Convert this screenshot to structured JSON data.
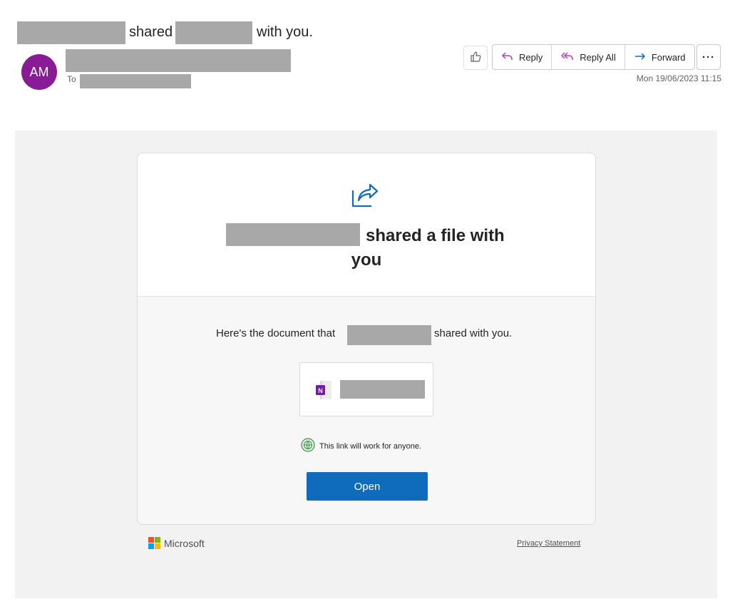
{
  "header": {
    "subject_shared": "shared",
    "subject_with_you": "with you.",
    "avatar_initials": "AM",
    "to_label": "To",
    "timestamp": "Mon 19/06/2023 11:15"
  },
  "actions": {
    "reply": "Reply",
    "reply_all": "Reply All",
    "forward": "Forward",
    "more": "···"
  },
  "card": {
    "headline_part1": "shared a file with",
    "headline_part2": "you",
    "message_prefix": "Here's the document that",
    "message_suffix": "shared with you.",
    "link_note": "This link will work for anyone.",
    "open_button": "Open"
  },
  "footer": {
    "brand": "Microsoft",
    "privacy": "Privacy Statement"
  },
  "colors": {
    "avatar": "#8a1b96",
    "primary_button": "#0f6cbd",
    "share_icon": "#0f6cbd",
    "reply_icon": "#c239b3",
    "forward_icon": "#0f6cbd"
  },
  "icons": [
    "like-icon",
    "reply-icon",
    "reply-all-icon",
    "forward-icon",
    "share-arrow-icon",
    "onenote-icon",
    "globe-icon",
    "microsoft-logo-icon"
  ]
}
